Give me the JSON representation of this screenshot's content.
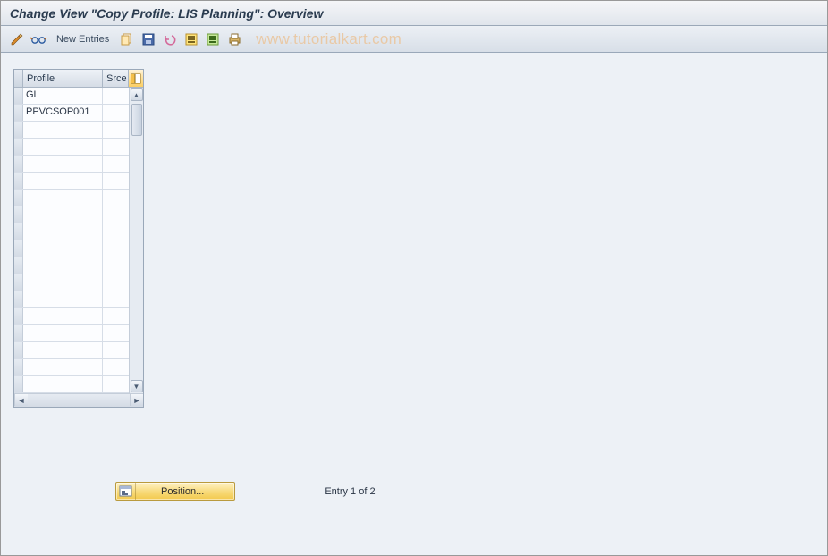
{
  "header": {
    "title": "Change View \"Copy Profile: LIS Planning\": Overview"
  },
  "toolbar": {
    "new_entries_label": "New Entries",
    "watermark": "www.tutorialkart.com"
  },
  "grid": {
    "columns": {
      "profile": "Profile",
      "srce": "Srce"
    },
    "rows": [
      {
        "profile": "GL",
        "srce": ""
      },
      {
        "profile": "PPVCSOP001",
        "srce": ""
      },
      {
        "profile": "",
        "srce": ""
      },
      {
        "profile": "",
        "srce": ""
      },
      {
        "profile": "",
        "srce": ""
      },
      {
        "profile": "",
        "srce": ""
      },
      {
        "profile": "",
        "srce": ""
      },
      {
        "profile": "",
        "srce": ""
      },
      {
        "profile": "",
        "srce": ""
      },
      {
        "profile": "",
        "srce": ""
      },
      {
        "profile": "",
        "srce": ""
      },
      {
        "profile": "",
        "srce": ""
      },
      {
        "profile": "",
        "srce": ""
      },
      {
        "profile": "",
        "srce": ""
      },
      {
        "profile": "",
        "srce": ""
      },
      {
        "profile": "",
        "srce": ""
      },
      {
        "profile": "",
        "srce": ""
      },
      {
        "profile": "",
        "srce": ""
      }
    ]
  },
  "footer": {
    "position_label": "Position...",
    "entry_text": "Entry 1 of 2"
  }
}
